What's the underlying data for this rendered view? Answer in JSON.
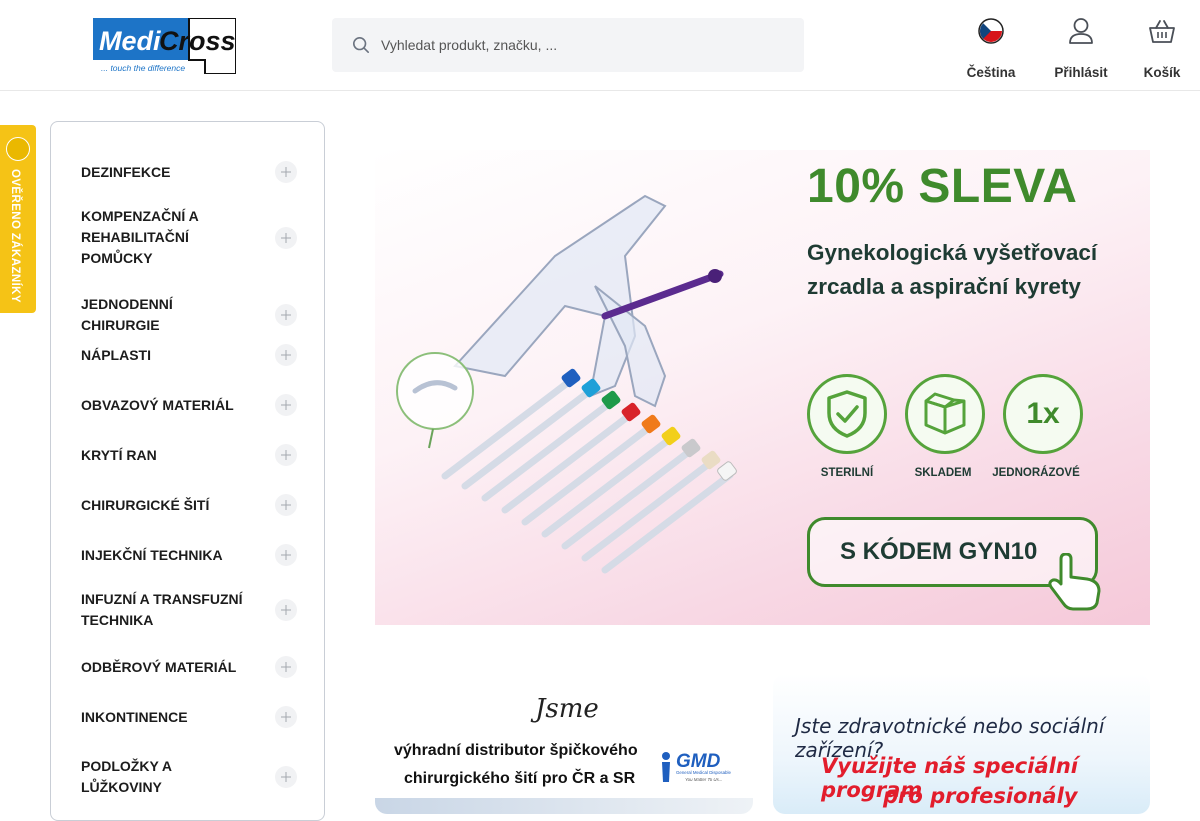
{
  "brand": {
    "logo_text": "MediCross",
    "tagline": "... touch the difference",
    "colors": {
      "logo_blue": "#1d74c7",
      "accent_green": "#3f8a2c",
      "badge_yellow": "#f5c316"
    }
  },
  "search": {
    "placeholder": "Vyhledat produkt, značku, ...",
    "value": "",
    "icon": "search-icon"
  },
  "header": {
    "language": {
      "label": "Čeština",
      "icon": "czech-flag-icon"
    },
    "login": {
      "label": "Přihlásit",
      "icon": "user-icon"
    },
    "cart": {
      "label": "Košík",
      "icon": "basket-icon"
    }
  },
  "verified_badge": {
    "label": "OVĚŘENO ZÁKAZNÍKY"
  },
  "categories": [
    {
      "label": "DEZINFEKCE"
    },
    {
      "label": "KOMPENZAČNÍ A REHABILITAČNÍ POMŮCKY"
    },
    {
      "label": "JEDNODENNÍ CHIRURGIE"
    },
    {
      "label": "NÁPLASTI"
    },
    {
      "label": "OBVAZOVÝ MATERIÁL"
    },
    {
      "label": "KRYTÍ RAN"
    },
    {
      "label": "CHIRURGICKÉ ŠITÍ"
    },
    {
      "label": "INJEKČNÍ TECHNIKA"
    },
    {
      "label": "INFUZNÍ A TRANSFUZNÍ TECHNIKA"
    },
    {
      "label": "ODBĚROVÝ MATERIÁL"
    },
    {
      "label": "INKONTINENCE"
    },
    {
      "label": "PODLOŽKY A LŮŽKOVINY"
    }
  ],
  "hero": {
    "headline": "10% SLEVA",
    "description": "Gynekologická vyšetřovací zrcadla a aspirační kyrety",
    "features": [
      {
        "label": "STERILNÍ",
        "icon": "shield-check-icon"
      },
      {
        "label": "SKLADEM",
        "icon": "box-icon"
      },
      {
        "label": "JEDNORÁZOVÉ",
        "icon_text": "1x"
      }
    ],
    "code_label": "S KÓDEM GYN10"
  },
  "banner_distributor": {
    "signature": "Jsme",
    "line1": "výhradní distributor špičkového",
    "line2": "chirurgického šití pro ČR a SR",
    "partner_logo": "GMD",
    "partner_sub": "General Medical Disposable",
    "partner_slogan": "You Matter To Us..."
  },
  "banner_program": {
    "line1": "Jste zdravotnické nebo sociální zařízení?",
    "line2": "Využijte náš speciální program",
    "line3": "pro profesionály"
  }
}
